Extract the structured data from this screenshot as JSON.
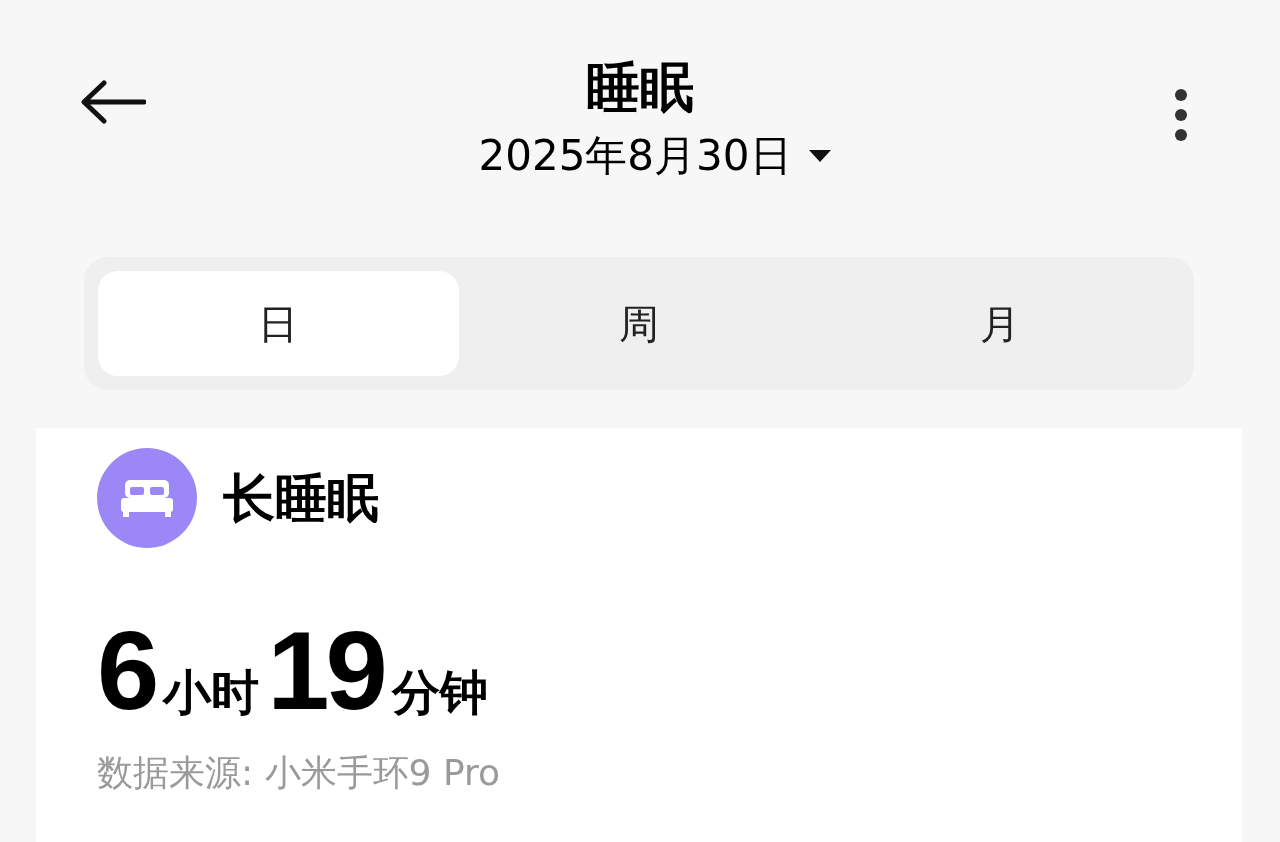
{
  "header": {
    "title": "睡眠",
    "date": "2025年8月30日"
  },
  "tabs": [
    {
      "label": "日",
      "selected": true
    },
    {
      "label": "周",
      "selected": false
    },
    {
      "label": "月",
      "selected": false
    }
  ],
  "card": {
    "title": "长睡眠",
    "duration": [
      {
        "kind": "number",
        "text": "6"
      },
      {
        "kind": "unit",
        "text": "小时"
      },
      {
        "kind": "number",
        "text": "19"
      },
      {
        "kind": "unit",
        "text": "分钟"
      }
    ],
    "source": "数据来源: 小米手环9 Pro"
  }
}
